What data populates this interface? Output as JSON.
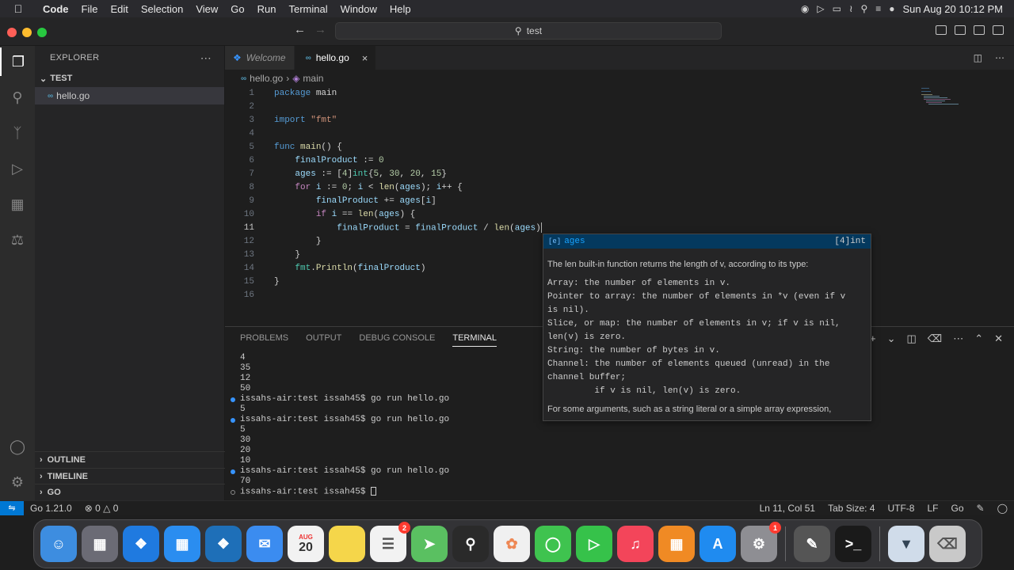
{
  "menubar": {
    "items": [
      "Code",
      "File",
      "Edit",
      "Selection",
      "View",
      "Go",
      "Run",
      "Terminal",
      "Window",
      "Help"
    ],
    "clock": "Sun Aug 20  10:12 PM"
  },
  "titlebar": {
    "search": "test"
  },
  "sidebar": {
    "title": "EXPLORER",
    "folder": "TEST",
    "file": "hello.go",
    "sections": [
      "OUTLINE",
      "TIMELINE",
      "GO"
    ]
  },
  "tabs": [
    {
      "label": "Welcome"
    },
    {
      "label": "hello.go",
      "close": "×"
    }
  ],
  "breadcrumb": {
    "file": "hello.go",
    "symbol": "main"
  },
  "editor": {
    "line_numbers": [
      "1",
      "2",
      "3",
      "4",
      "5",
      "6",
      "7",
      "8",
      "9",
      "10",
      "11",
      "12",
      "13",
      "14",
      "15",
      "16"
    ]
  },
  "suggest": {
    "label": "ages",
    "detail": "[4]int",
    "summary": "The len built-in function returns the length of v, according to its type:",
    "details": [
      "Array: the number of elements in v.",
      "Pointer to array: the number of elements in *v (even if v",
      "is nil).",
      "Slice, or map: the number of elements in v; if v is nil,",
      "len(v) is zero.",
      "String: the number of bytes in v.",
      "Channel: the number of elements queued (unread) in the",
      "channel buffer;",
      "         if v is nil, len(v) is zero."
    ],
    "tail": "For some arguments, such as a string literal or a simple array expression,"
  },
  "panel": {
    "tabs": [
      "PROBLEMS",
      "OUTPUT",
      "DEBUG CONSOLE",
      "TERMINAL"
    ],
    "terminal": {
      "out1": [
        "4",
        "35",
        "12",
        "50"
      ],
      "prompt1": "issahs-air:test issah45$ go run hello.go",
      "out2": [
        "5"
      ],
      "prompt2": "issahs-air:test issah45$ go run hello.go",
      "out3": [
        "5",
        "30",
        "20",
        "10"
      ],
      "prompt3": "issahs-air:test issah45$ go run hello.go",
      "out4": [
        "70"
      ],
      "prompt4": "issahs-air:test issah45$ "
    }
  },
  "status": {
    "go_version": "Go 1.21.0",
    "problems": "0",
    "warnings": "0",
    "position": "Ln 11, Col 51",
    "tab_size": "Tab Size: 4",
    "encoding": "UTF-8",
    "eol": "LF",
    "language": "Go"
  },
  "dock": {
    "calendar_month": "AUG",
    "calendar_day": "20",
    "reminders_badge": "2",
    "settings_badge": "1"
  }
}
